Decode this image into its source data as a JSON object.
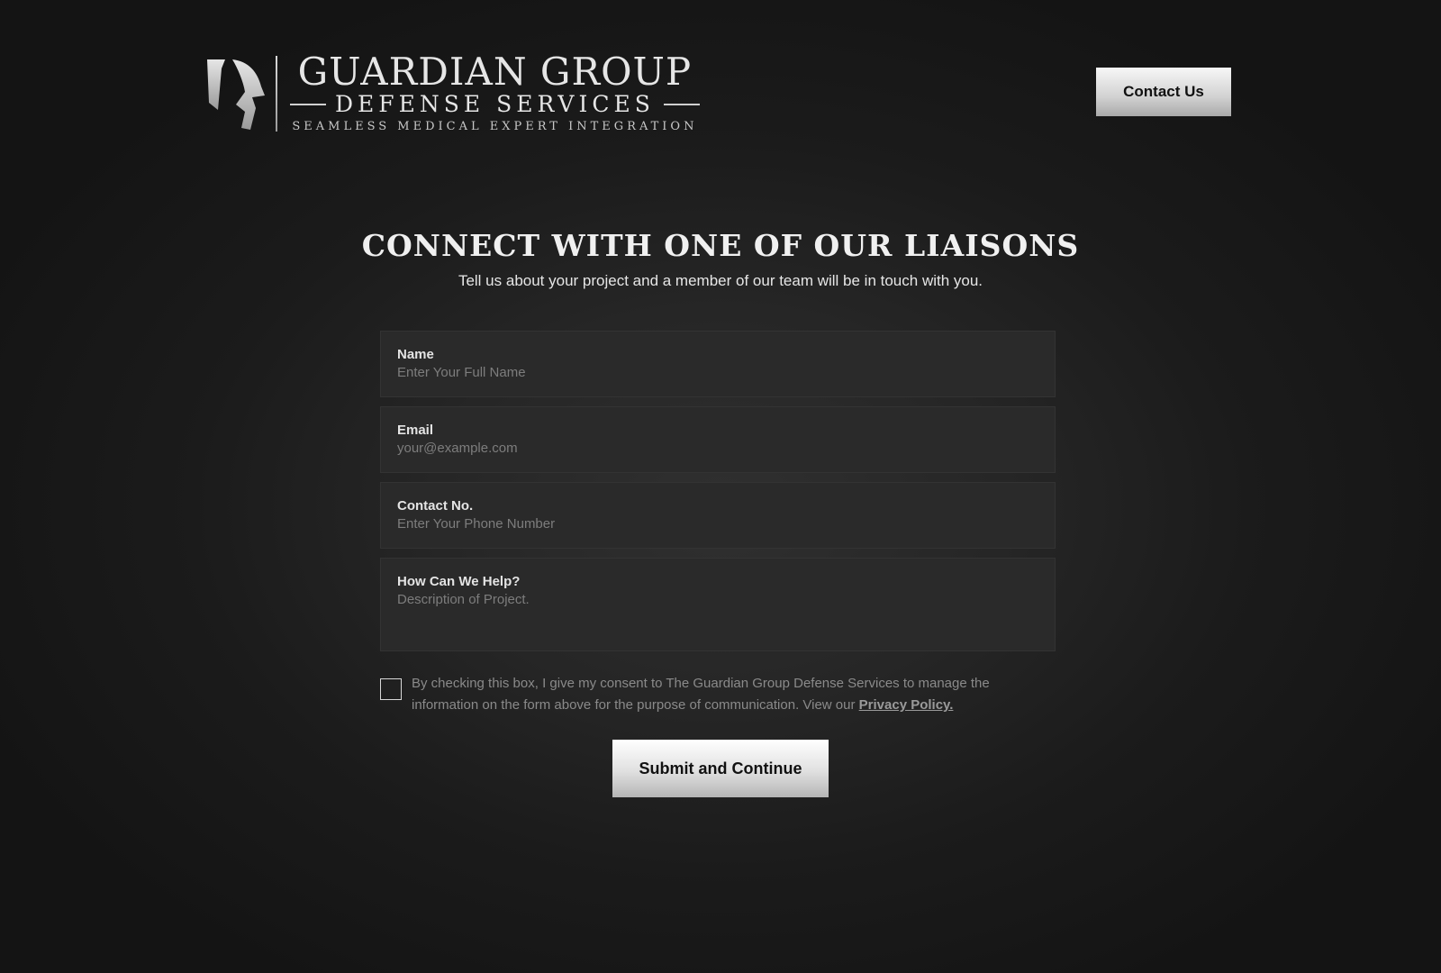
{
  "header": {
    "logo": {
      "line1": "GUARDIAN GROUP",
      "line2": "DEFENSE SERVICES",
      "line3": "SEAMLESS MEDICAL EXPERT INTEGRATION",
      "icon": "spartan-helmet-icon"
    },
    "contact_button": "Contact Us"
  },
  "main": {
    "heading": "CONNECT WITH ONE OF OUR LIAISONS",
    "subheading": "Tell us about your project and a member of our team will be in touch with you."
  },
  "form": {
    "fields": [
      {
        "label": "Name",
        "placeholder": "Enter Your Full Name",
        "value": ""
      },
      {
        "label": "Email",
        "placeholder": "your@example.com",
        "value": ""
      },
      {
        "label": "Contact No.",
        "placeholder": "Enter Your Phone Number",
        "value": ""
      },
      {
        "label": "How Can We Help?",
        "placeholder": "Description of Project.",
        "value": ""
      }
    ],
    "consent": {
      "text": "By checking this box, I give my consent to The Guardian Group Defense Services to manage the information on the form above for the purpose of communication. View our ",
      "link": "Privacy Policy.",
      "checked": false
    },
    "submit_label": "Submit and Continue"
  },
  "colors": {
    "background": "#141414",
    "field_background": "#2a2a2a",
    "button_light": "#f7f7f7",
    "button_dark": "#a9a9a9"
  }
}
